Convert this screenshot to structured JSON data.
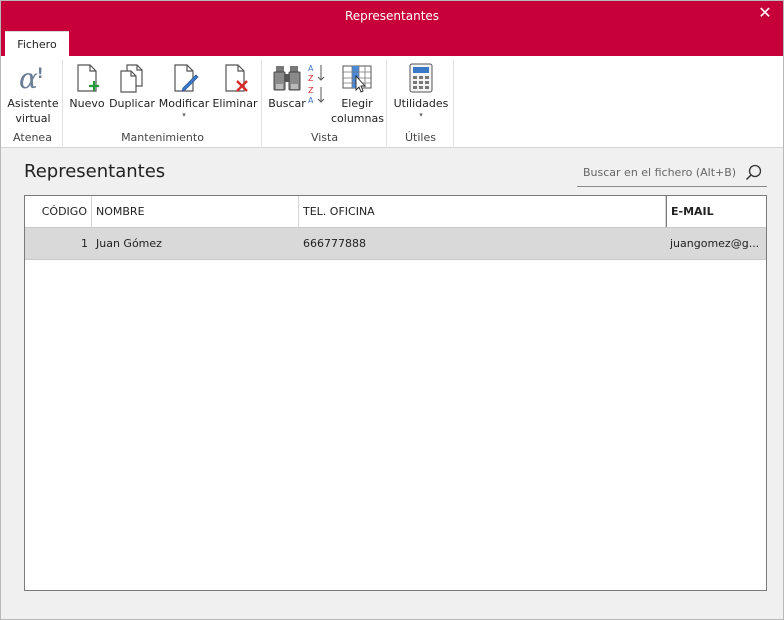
{
  "window": {
    "title": "Representantes",
    "close_symbol": "✕"
  },
  "tabs": [
    {
      "label": "Fichero",
      "active": true
    }
  ],
  "ribbon": {
    "groups": [
      {
        "label": "Atenea",
        "buttons": [
          {
            "label1": "Asistente",
            "label2": "virtual",
            "icon": "alpha-assistant-icon"
          }
        ]
      },
      {
        "label": "Mantenimiento",
        "buttons": [
          {
            "label1": "Nuevo",
            "icon": "new-document-icon"
          },
          {
            "label1": "Duplicar",
            "icon": "duplicate-icon"
          },
          {
            "label1": "Modificar",
            "icon": "edit-document-icon",
            "dropdown": "▾"
          },
          {
            "label1": "Eliminar",
            "icon": "delete-document-icon"
          }
        ]
      },
      {
        "label": "Vista",
        "buttons": [
          {
            "label1": "Buscar",
            "icon": "binoculars-icon"
          },
          {
            "label1": "",
            "icon": "sort-az-icon"
          },
          {
            "label1": "Elegir",
            "label2": "columnas",
            "icon": "choose-columns-icon"
          }
        ]
      },
      {
        "label": "Útiles",
        "buttons": [
          {
            "label1": "Utilidades",
            "icon": "calculator-icon",
            "dropdown": "▾"
          }
        ]
      }
    ]
  },
  "main": {
    "title": "Representantes",
    "search_placeholder": "Buscar en el fichero (Alt+B)"
  },
  "table": {
    "columns": [
      "CÓDIGO",
      "NOMBRE",
      "TEL. OFICINA",
      "E-MAIL"
    ],
    "rows": [
      [
        "1",
        "Juan Gómez",
        "666777888",
        "juangomez@g..."
      ]
    ]
  },
  "colors": {
    "accent": "#c8003a",
    "selected_row": "#d9d9d9"
  }
}
